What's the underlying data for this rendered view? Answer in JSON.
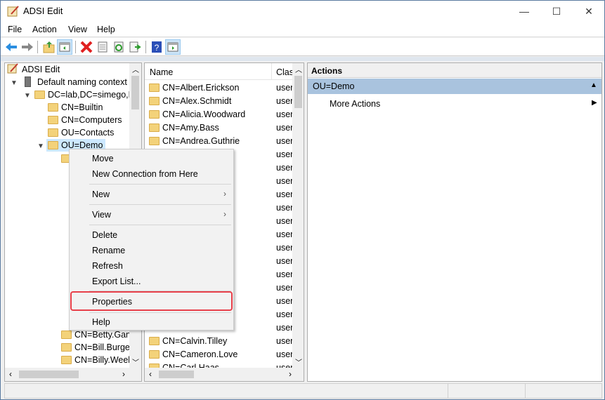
{
  "window": {
    "title": "ADSI Edit",
    "minimize": "—",
    "maximize": "☐",
    "close": "✕"
  },
  "menu": [
    "File",
    "Action",
    "View",
    "Help"
  ],
  "toolbar": [
    "back-icon",
    "forward-icon",
    "up-folder-icon",
    "show-hide-console-tree-icon",
    "delete-icon",
    "properties-icon",
    "refresh-icon",
    "export-list-icon",
    "help-icon",
    "show-hide-action-pane-icon"
  ],
  "tree": {
    "root": "ADSI Edit",
    "items": [
      {
        "label": "Default naming context [",
        "level": 1,
        "expanded": true
      },
      {
        "label": "DC=lab,DC=simego,D",
        "level": 2,
        "expanded": true
      },
      {
        "label": "CN=Builtin",
        "level": 3
      },
      {
        "label": "CN=Computers",
        "level": 3
      },
      {
        "label": "OU=Contacts",
        "level": 3
      },
      {
        "label": "OU=Demo",
        "level": 3,
        "expanded": true,
        "selected": true
      }
    ],
    "visible_children": [
      "CN=Betty.Gan",
      "CN=Bill.Burge",
      "CN=Billy.Weel"
    ]
  },
  "list": {
    "columns": [
      "Name",
      "Clas"
    ],
    "rows": [
      {
        "name": "CN=Albert.Erickson",
        "class": "user"
      },
      {
        "name": "CN=Alex.Schmidt",
        "class": "user"
      },
      {
        "name": "CN=Alicia.Woodward",
        "class": "user"
      },
      {
        "name": "CN=Amy.Bass",
        "class": "user"
      },
      {
        "name": "CN=Andrea.Guthrie",
        "class": "user"
      },
      {
        "name": "",
        "class": "user"
      },
      {
        "name": "th",
        "class": "user"
      },
      {
        "name": "",
        "class": "user"
      },
      {
        "name": "",
        "class": "user"
      },
      {
        "name": "s",
        "class": "user"
      },
      {
        "name": "",
        "class": "user"
      },
      {
        "name": "n",
        "class": "user"
      },
      {
        "name": "son",
        "class": "user"
      },
      {
        "name": "ty",
        "class": "user"
      },
      {
        "name": "",
        "class": "user"
      },
      {
        "name": "",
        "class": "user"
      },
      {
        "name": "",
        "class": "user"
      },
      {
        "name": "",
        "class": "user"
      },
      {
        "name": "",
        "class": "user"
      },
      {
        "name": "CN=Calvin.Tilley",
        "class": "user"
      },
      {
        "name": "CN=Cameron.Love",
        "class": "user"
      },
      {
        "name": "CN=Carl.Haas",
        "class": "user"
      }
    ]
  },
  "actions": {
    "header": "Actions",
    "section": "OU=Demo",
    "items": [
      "More Actions"
    ]
  },
  "context_menu": {
    "items": [
      "Move",
      "New Connection from Here",
      "New",
      "View",
      "Delete",
      "Rename",
      "Refresh",
      "Export List...",
      "Properties",
      "Help"
    ],
    "highlighted": "Properties",
    "highlight_color": "#e8404a"
  }
}
